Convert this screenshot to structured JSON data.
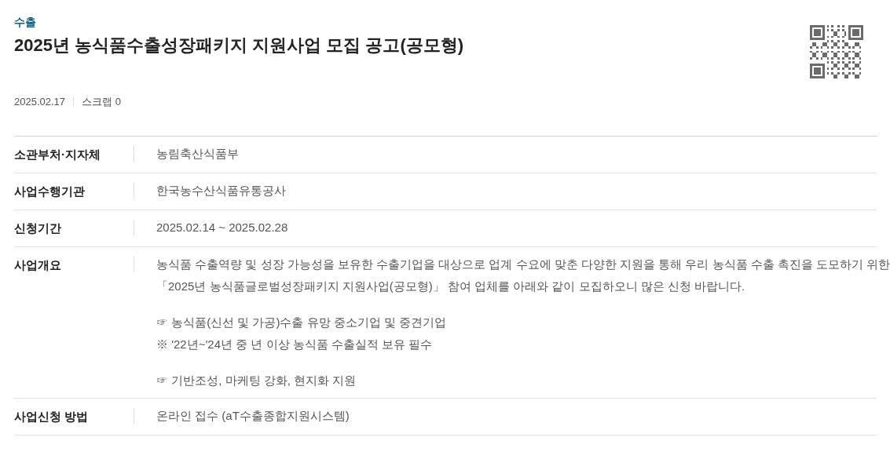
{
  "category": "수출",
  "title": "2025년 농식품수출성장패키지 지원사업 모집 공고(공모형)",
  "date": "2025.02.17",
  "scrap": "스크랩 0",
  "rows": [
    {
      "label": "소관부처·지자체",
      "blocks": [
        [
          "농림축산식품부"
        ]
      ]
    },
    {
      "label": "사업수행기관",
      "blocks": [
        [
          "한국농수산식품유통공사"
        ]
      ]
    },
    {
      "label": "신청기간",
      "blocks": [
        [
          "2025.02.14 ~ 2025.02.28"
        ]
      ]
    },
    {
      "label": "사업개요",
      "blocks": [
        [
          "농식품 수출역량 및 성장 가능성을 보유한 수출기업을 대상으로 업계 수요에 맞춘 다양한 지원을 통해 우리 농식품 수출 촉진을 도모하기 위한",
          "「2025년 농식품글로벌성장패키지 지원사업(공모형)」 참여 업체를 아래와 같이 모집하오니 많은 신청 바랍니다."
        ],
        [
          "☞ 농식품(신선 및 가공)수출 유망 중소기업 및 중견기업",
          "※  '22년~'24년 중 년 이상 농식품 수출실적 보유 필수"
        ],
        [
          "☞ 기반조성, 마케팅 강화, 현지화 지원"
        ]
      ]
    },
    {
      "label": "사업신청 방법",
      "blocks": [
        [
          "온라인 접수 (aT수출종합지원시스템)"
        ]
      ]
    }
  ]
}
